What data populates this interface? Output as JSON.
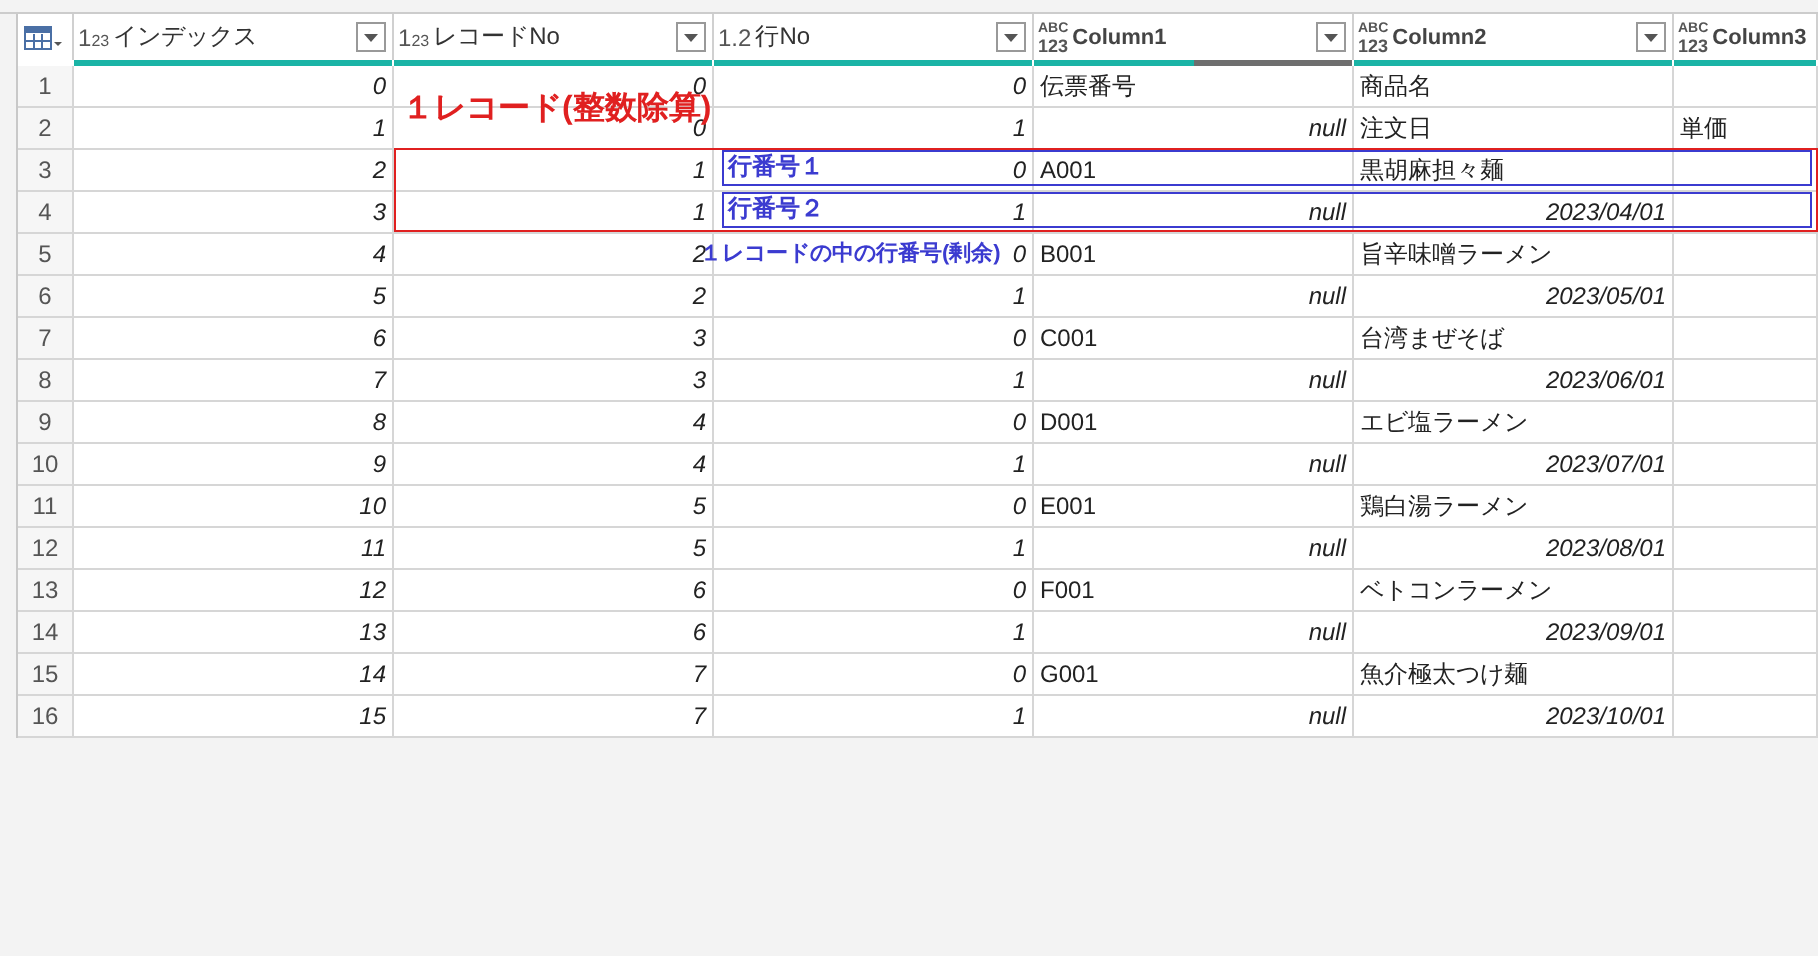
{
  "columns": [
    {
      "kind": "int",
      "type_glyph": [
        "1",
        "2",
        "3"
      ],
      "name": "インデックス",
      "filter": true,
      "level": 1
    },
    {
      "kind": "int",
      "type_glyph": [
        "1",
        "2",
        "3"
      ],
      "name": "レコードNo",
      "filter": true,
      "level": 1
    },
    {
      "kind": "decimal",
      "type_glyph": [
        "1.2"
      ],
      "name": "行No",
      "filter": true,
      "level": 1
    },
    {
      "kind": "any",
      "type_glyph": [
        "ABC",
        "123"
      ],
      "name": "Column1",
      "filter": true,
      "level": 0.5
    },
    {
      "kind": "any",
      "type_glyph": [
        "ABC",
        "123"
      ],
      "name": "Column2",
      "filter": true,
      "level": 1
    },
    {
      "kind": "any",
      "type_glyph": [
        "ABC",
        "123"
      ],
      "name": "Column3",
      "filter": false,
      "level": 1
    }
  ],
  "rows": [
    {
      "n": "1",
      "cells": [
        {
          "kind": "value",
          "text": "0"
        },
        {
          "kind": "value",
          "text": "0"
        },
        {
          "kind": "value",
          "text": "0"
        },
        {
          "kind": "text",
          "text": "伝票番号"
        },
        {
          "kind": "text",
          "text": "商品名"
        },
        null
      ]
    },
    {
      "n": "2",
      "cells": [
        {
          "kind": "value",
          "text": "1"
        },
        {
          "kind": "value",
          "text": "0"
        },
        {
          "kind": "value",
          "text": "1"
        },
        {
          "kind": "value",
          "text": "null"
        },
        {
          "kind": "text",
          "text": "注文日"
        },
        {
          "kind": "text",
          "text": "単価"
        }
      ]
    },
    {
      "n": "3",
      "cells": [
        {
          "kind": "value",
          "text": "2"
        },
        {
          "kind": "value",
          "text": "1"
        },
        {
          "kind": "value",
          "text": "0"
        },
        {
          "kind": "text",
          "text": "A001"
        },
        {
          "kind": "text",
          "text": "黒胡麻担々麺"
        },
        null
      ]
    },
    {
      "n": "4",
      "cells": [
        {
          "kind": "value",
          "text": "3"
        },
        {
          "kind": "value",
          "text": "1"
        },
        {
          "kind": "value",
          "text": "1"
        },
        {
          "kind": "value",
          "text": "null"
        },
        {
          "kind": "value",
          "text": "2023/04/01"
        },
        null
      ]
    },
    {
      "n": "5",
      "cells": [
        {
          "kind": "value",
          "text": "4"
        },
        {
          "kind": "value",
          "text": "2"
        },
        {
          "kind": "value",
          "text": "0"
        },
        {
          "kind": "text",
          "text": "B001"
        },
        {
          "kind": "text",
          "text": "旨辛味噌ラーメン"
        },
        null
      ]
    },
    {
      "n": "6",
      "cells": [
        {
          "kind": "value",
          "text": "5"
        },
        {
          "kind": "value",
          "text": "2"
        },
        {
          "kind": "value",
          "text": "1"
        },
        {
          "kind": "value",
          "text": "null"
        },
        {
          "kind": "value",
          "text": "2023/05/01"
        },
        null
      ]
    },
    {
      "n": "7",
      "cells": [
        {
          "kind": "value",
          "text": "6"
        },
        {
          "kind": "value",
          "text": "3"
        },
        {
          "kind": "value",
          "text": "0"
        },
        {
          "kind": "text",
          "text": "C001"
        },
        {
          "kind": "text",
          "text": "台湾まぜそば"
        },
        null
      ]
    },
    {
      "n": "8",
      "cells": [
        {
          "kind": "value",
          "text": "7"
        },
        {
          "kind": "value",
          "text": "3"
        },
        {
          "kind": "value",
          "text": "1"
        },
        {
          "kind": "value",
          "text": "null"
        },
        {
          "kind": "value",
          "text": "2023/06/01"
        },
        null
      ]
    },
    {
      "n": "9",
      "cells": [
        {
          "kind": "value",
          "text": "8"
        },
        {
          "kind": "value",
          "text": "4"
        },
        {
          "kind": "value",
          "text": "0"
        },
        {
          "kind": "text",
          "text": "D001"
        },
        {
          "kind": "text",
          "text": "エビ塩ラーメン"
        },
        null
      ]
    },
    {
      "n": "10",
      "cells": [
        {
          "kind": "value",
          "text": "9"
        },
        {
          "kind": "value",
          "text": "4"
        },
        {
          "kind": "value",
          "text": "1"
        },
        {
          "kind": "value",
          "text": "null"
        },
        {
          "kind": "value",
          "text": "2023/07/01"
        },
        null
      ]
    },
    {
      "n": "11",
      "cells": [
        {
          "kind": "value",
          "text": "10"
        },
        {
          "kind": "value",
          "text": "5"
        },
        {
          "kind": "value",
          "text": "0"
        },
        {
          "kind": "text",
          "text": "E001"
        },
        {
          "kind": "text",
          "text": "鶏白湯ラーメン"
        },
        null
      ]
    },
    {
      "n": "12",
      "cells": [
        {
          "kind": "value",
          "text": "11"
        },
        {
          "kind": "value",
          "text": "5"
        },
        {
          "kind": "value",
          "text": "1"
        },
        {
          "kind": "value",
          "text": "null"
        },
        {
          "kind": "value",
          "text": "2023/08/01"
        },
        null
      ]
    },
    {
      "n": "13",
      "cells": [
        {
          "kind": "value",
          "text": "12"
        },
        {
          "kind": "value",
          "text": "6"
        },
        {
          "kind": "value",
          "text": "0"
        },
        {
          "kind": "text",
          "text": "F001"
        },
        {
          "kind": "text",
          "text": "ベトコンラーメン"
        },
        null
      ]
    },
    {
      "n": "14",
      "cells": [
        {
          "kind": "value",
          "text": "13"
        },
        {
          "kind": "value",
          "text": "6"
        },
        {
          "kind": "value",
          "text": "1"
        },
        {
          "kind": "value",
          "text": "null"
        },
        {
          "kind": "value",
          "text": "2023/09/01"
        },
        null
      ]
    },
    {
      "n": "15",
      "cells": [
        {
          "kind": "value",
          "text": "14"
        },
        {
          "kind": "value",
          "text": "7"
        },
        {
          "kind": "value",
          "text": "0"
        },
        {
          "kind": "text",
          "text": "G001"
        },
        {
          "kind": "text",
          "text": "魚介極太つけ麺"
        },
        null
      ]
    },
    {
      "n": "16",
      "cells": [
        {
          "kind": "value",
          "text": "15"
        },
        {
          "kind": "value",
          "text": "7"
        },
        {
          "kind": "value",
          "text": "1"
        },
        {
          "kind": "value",
          "text": "null"
        },
        {
          "kind": "value",
          "text": "2023/10/01"
        },
        null
      ]
    }
  ],
  "annotations": [
    {
      "kind": "frame",
      "color": "#e02020"
    },
    {
      "kind": "frame",
      "color": "#3b3bd0"
    },
    {
      "kind": "frame",
      "color": "#3b3bd0"
    },
    {
      "kind": "label",
      "text": "１レコード(整数除算)",
      "color": "#e02020"
    },
    {
      "kind": "label",
      "text": "行番号１",
      "color": "#3b3bd0"
    },
    {
      "kind": "label",
      "text": "行番号２",
      "color": "#3b3bd0"
    },
    {
      "kind": "label",
      "text": "１レコードの中の行番号(剰余)",
      "color": "#3b3bd0"
    }
  ]
}
